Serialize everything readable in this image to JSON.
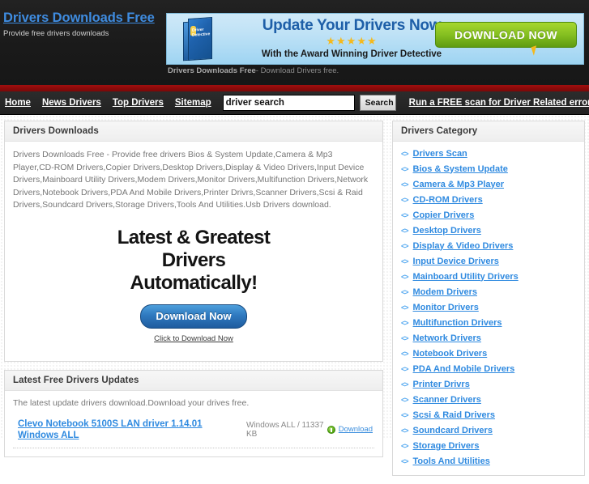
{
  "header": {
    "logo_title": "Drivers Downloads Free",
    "logo_subtitle": "Provide free drivers downloads",
    "banner": {
      "headline": "Update Your Drivers Now",
      "stars": "★★★★★",
      "subline": "With the Award Winning Driver Detective",
      "button_label": "DOWNLOAD NOW",
      "box_label": "Driver Detective",
      "caption_bold": "Drivers Downloads Free",
      "caption_rest": "- Download Drivers free."
    }
  },
  "nav": {
    "items": [
      {
        "label": "Home"
      },
      {
        "label": "News Drivers"
      },
      {
        "label": "Top Drivers"
      },
      {
        "label": "Sitemap"
      }
    ],
    "search_value": "driver search",
    "search_placeholder": "driver search",
    "search_button": "Search",
    "cta_label": "Run a FREE scan for Driver Related errors"
  },
  "main": {
    "panel_title": "Drivers Downloads",
    "intro": "Drivers Downloads Free - Provide free drivers Bios & System Update,Camera & Mp3 Player,CD-ROM Drivers,Copier Drivers,Desktop Drivers,Display & Video Drivers,Input Device Drivers,Mainboard Utility Drivers,Modem Drivers,Monitor Drivers,Multifunction Drivers,Network Drivers,Notebook Drivers,PDA And Mobile Drivers,Printer Drivrs,Scanner Drivers,Scsi & Raid Drivers,Soundcard Drivers,Storage Drivers,Tools And Utilities.Usb Drivers download.",
    "promo": {
      "line1": "Latest & Greatest",
      "line2": "Drivers",
      "line3": "Automatically!",
      "button_label": "Download Now",
      "link_label": "Click to Download Now"
    },
    "updates": {
      "panel_title": "Latest Free Drivers Updates",
      "note": "The latest update drivers download.Download your drives free.",
      "rows": [
        {
          "title": "Clevo Notebook 5100S LAN driver 1.14.01 Windows ALL",
          "meta": "Windows ALL / 11337 KB",
          "download_label": "Download",
          "download_icon": "green-download-icon"
        }
      ]
    }
  },
  "sidebar": {
    "panel_title": "Drivers Category",
    "bullet_icon": "<>",
    "items": [
      {
        "label": "Drivers Scan"
      },
      {
        "label": "Bios & System Update"
      },
      {
        "label": "Camera & Mp3 Player"
      },
      {
        "label": "CD-ROM Drivers"
      },
      {
        "label": "Copier Drivers"
      },
      {
        "label": "Desktop Drivers"
      },
      {
        "label": "Display & Video Drivers"
      },
      {
        "label": "Input Device Drivers"
      },
      {
        "label": "Mainboard Utility Drivers"
      },
      {
        "label": "Modem Drivers"
      },
      {
        "label": "Monitor Drivers"
      },
      {
        "label": "Multifunction Drivers"
      },
      {
        "label": "Network Drivers"
      },
      {
        "label": "Notebook Drivers"
      },
      {
        "label": "PDA And Mobile Drivers"
      },
      {
        "label": "Printer Drivrs"
      },
      {
        "label": "Scanner Drivers"
      },
      {
        "label": "Scsi & Raid Drivers"
      },
      {
        "label": "Soundcard Drivers"
      },
      {
        "label": "Storage Drivers"
      },
      {
        "label": "Tools And Utilities"
      }
    ]
  },
  "colors": {
    "link_blue": "#2f8ae0",
    "header_dark": "#1d1d1d",
    "red_bar": "#8f0b0b",
    "green_button": "#86c021"
  }
}
